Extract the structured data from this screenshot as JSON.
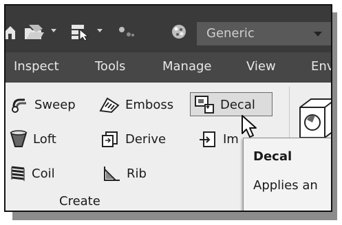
{
  "quick_access": {
    "icons": [
      "home-icon",
      "open-icon",
      "select-icon",
      "appearance-icon",
      "material-ball-icon"
    ],
    "appearance_value": "Generic"
  },
  "tabs": [
    "Inspect",
    "Tools",
    "Manage",
    "View",
    "Env"
  ],
  "create_panel": {
    "tools": {
      "sweep": "Sweep",
      "emboss": "Emboss",
      "decal": "Decal",
      "loft": "Loft",
      "derive": "Derive",
      "import": "Im",
      "coil": "Coil",
      "rib": "Rib"
    },
    "group_label": "Create"
  },
  "tooltip": {
    "title": "Decal",
    "description": "Applies an"
  }
}
